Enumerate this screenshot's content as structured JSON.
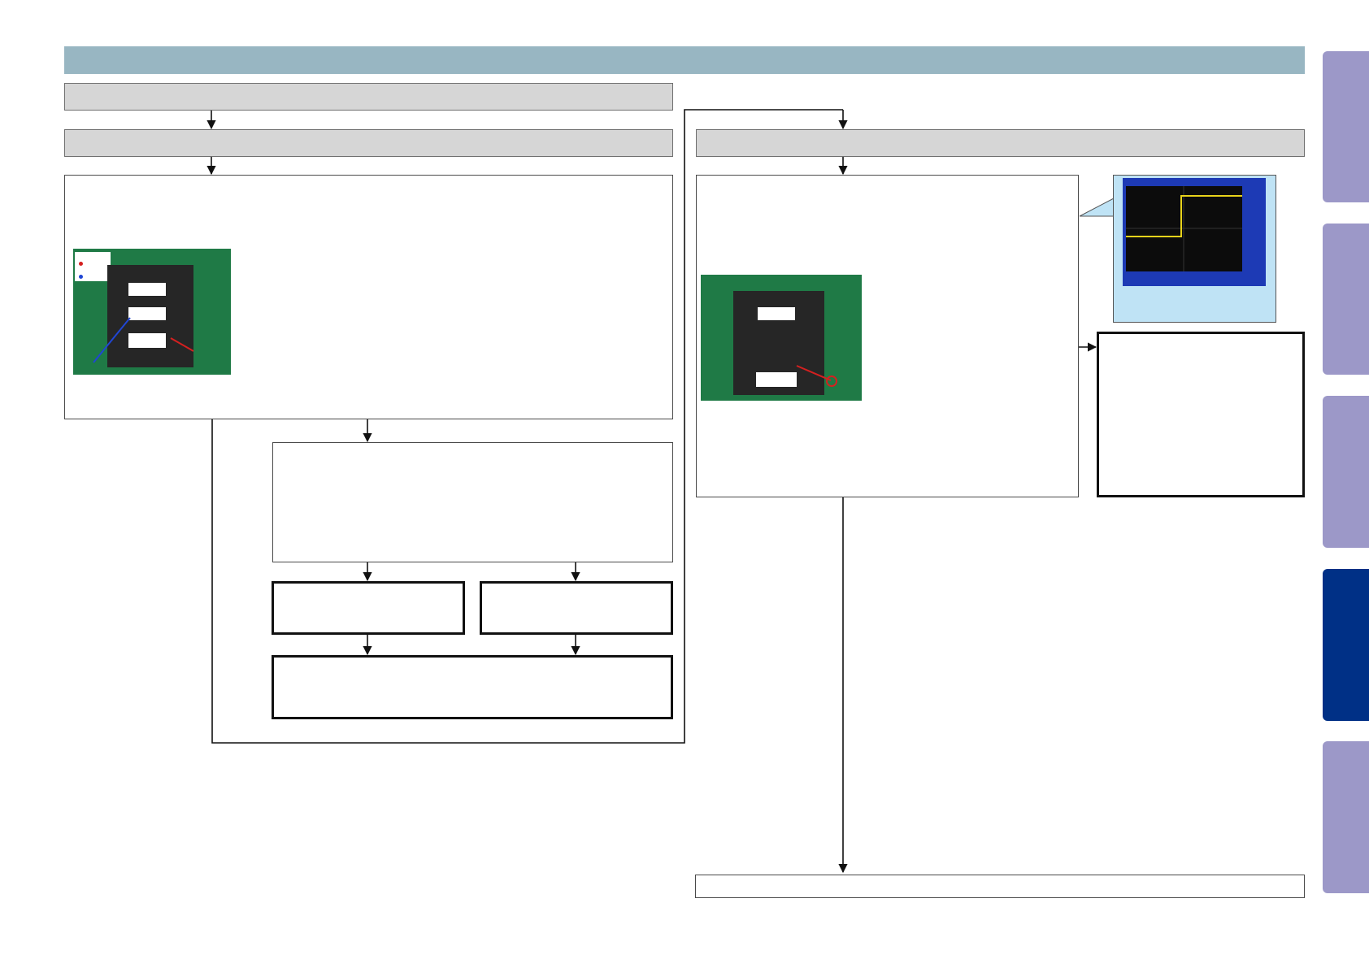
{
  "header": {
    "title": ""
  },
  "flow_left": {
    "step1": "",
    "step2": "",
    "check_box": "",
    "decision_box": "",
    "branch_a": "",
    "branch_b": "",
    "result_box": ""
  },
  "flow_right": {
    "step1": "",
    "check_box": "",
    "note_box": "",
    "result_box": ""
  },
  "side_tabs": [
    "",
    "",
    "",
    "",
    ""
  ],
  "active_tab_index": 3,
  "colors": {
    "header": "#98b6c2",
    "gray_box": "#d6d6d6",
    "side_tab": "#9c98c8",
    "side_tab_active": "#003086",
    "scope_background": "#bfe3f5",
    "scope_trace": "#e8d21a",
    "pcb_green": "#1f7a46",
    "probe_red": "#d42020",
    "probe_blue": "#2046d4"
  },
  "icons": [
    "pcb-photo-icon",
    "ic-chip-icon",
    "oscilloscope-screen-icon",
    "arrow-down-icon",
    "arrow-right-icon"
  ]
}
